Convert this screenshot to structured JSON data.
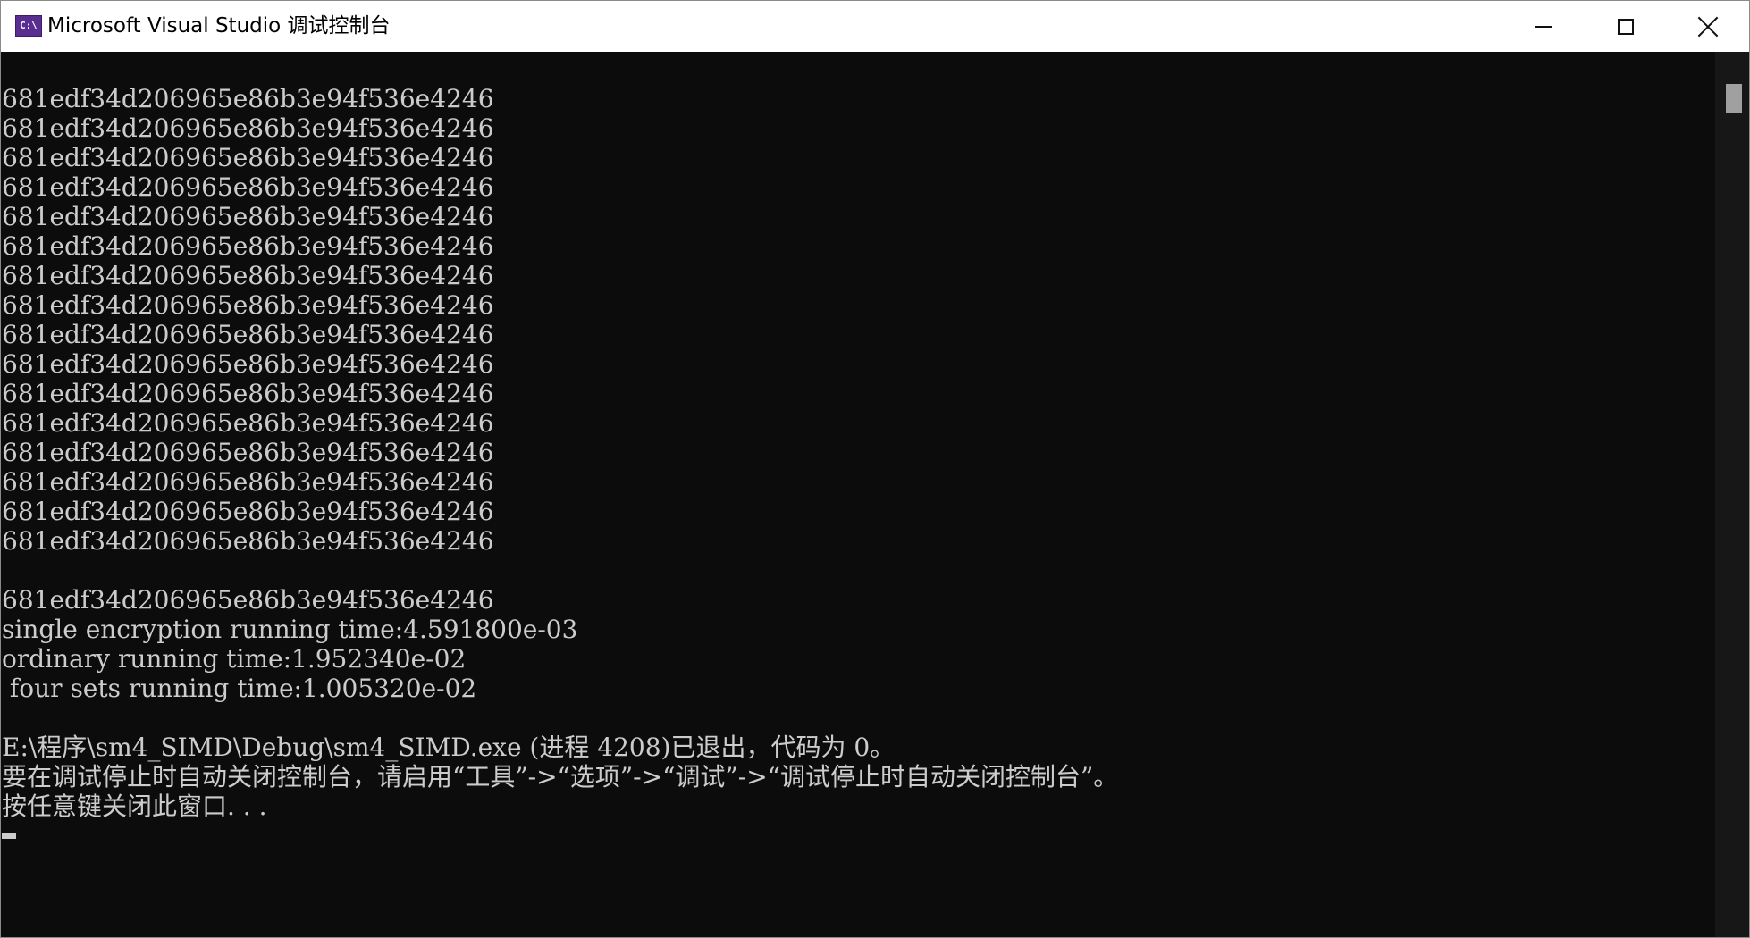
{
  "window": {
    "title": "Microsoft Visual Studio 调试控制台",
    "icon_label": "C:\\",
    "icon": "console-app-icon"
  },
  "controls": {
    "minimize": "minimize-icon",
    "maximize": "maximize-icon",
    "close": "close-icon"
  },
  "console": {
    "lines": [
      "681edf34d206965e86b3e94f536e4246",
      "681edf34d206965e86b3e94f536e4246",
      "681edf34d206965e86b3e94f536e4246",
      "681edf34d206965e86b3e94f536e4246",
      "681edf34d206965e86b3e94f536e4246",
      "681edf34d206965e86b3e94f536e4246",
      "681edf34d206965e86b3e94f536e4246",
      "681edf34d206965e86b3e94f536e4246",
      "681edf34d206965e86b3e94f536e4246",
      "681edf34d206965e86b3e94f536e4246",
      "681edf34d206965e86b3e94f536e4246",
      "681edf34d206965e86b3e94f536e4246",
      "681edf34d206965e86b3e94f536e4246",
      "681edf34d206965e86b3e94f536e4246",
      "681edf34d206965e86b3e94f536e4246",
      "681edf34d206965e86b3e94f536e4246",
      "",
      "681edf34d206965e86b3e94f536e4246",
      "single encryption running time:4.591800e-03",
      "ordinary running time:1.952340e-02",
      " four sets running time:1.005320e-02",
      "",
      "E:\\程序\\sm4_SIMD\\Debug\\sm4_SIMD.exe (进程 4208)已退出，代码为 0。",
      "要在调试停止时自动关闭控制台，请启用“工具”->“选项”->“调试”->“调试停止时自动关闭控制台”。",
      "按任意键关闭此窗口. . ."
    ]
  },
  "colors": {
    "console_bg": "#0c0c0c",
    "console_fg": "#cccccc",
    "titlebar_bg": "#ffffff",
    "icon_bg": "#5a2d91"
  }
}
